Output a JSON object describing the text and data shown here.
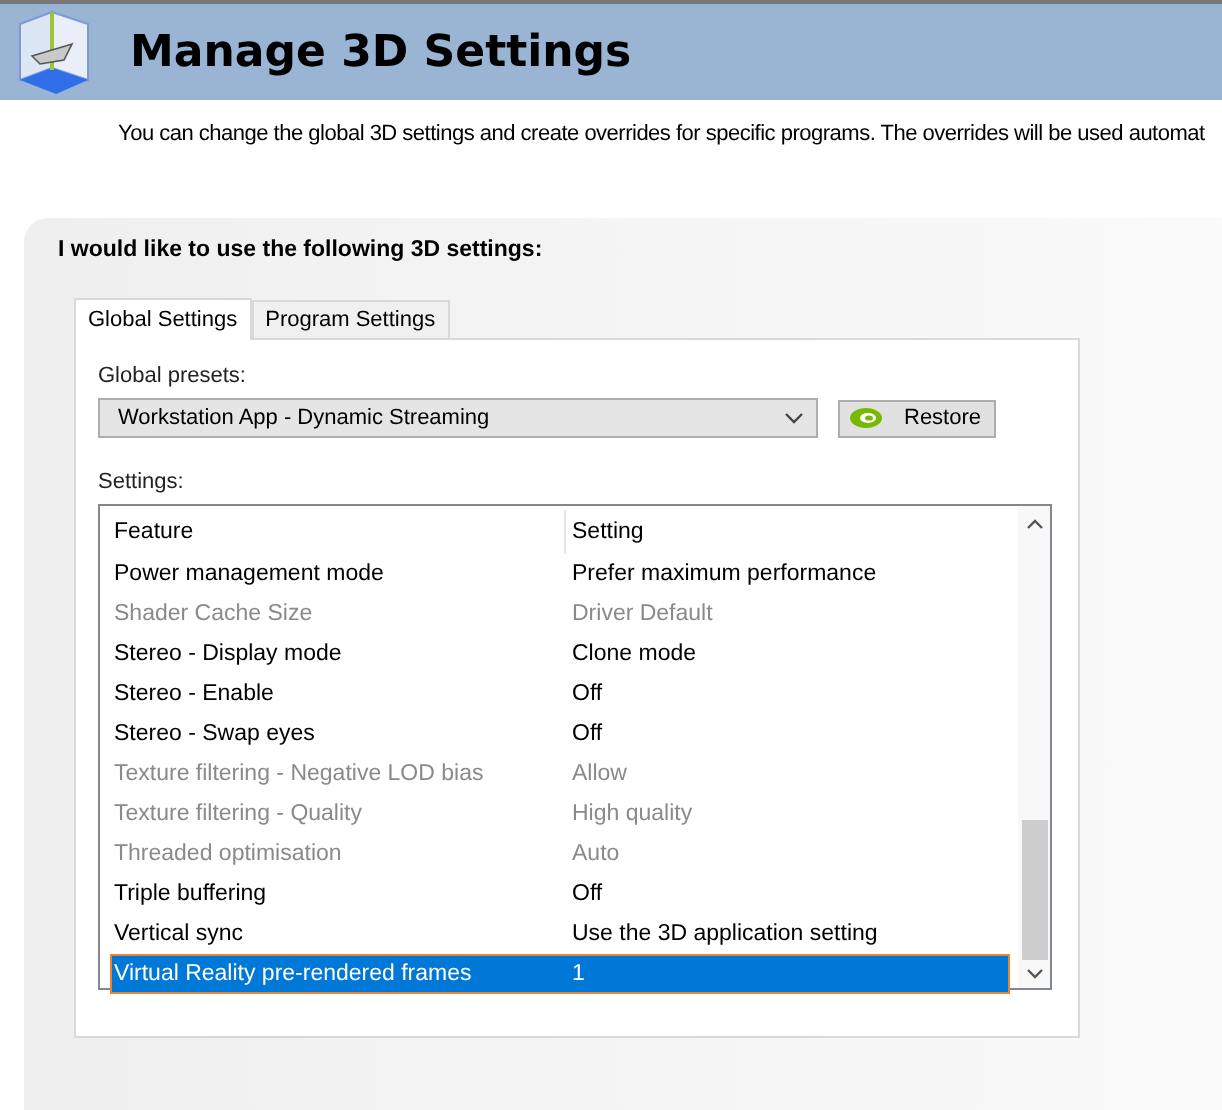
{
  "header": {
    "title": "Manage 3D Settings"
  },
  "description": "You can change the global 3D settings and create overrides for specific programs. The overrides will be used automat",
  "panel": {
    "heading": "I would like to use the following 3D settings:",
    "tabs": [
      {
        "label": "Global Settings",
        "selected": true
      },
      {
        "label": "Program Settings",
        "selected": false
      }
    ],
    "presets_label": "Global presets:",
    "preset": {
      "value": "Workstation App - Dynamic Streaming"
    },
    "restore_button": "Restore",
    "settings_label": "Settings:",
    "table": {
      "columns": [
        "Feature",
        "Setting"
      ],
      "rows": [
        {
          "feature": "Power management mode",
          "setting": "Prefer maximum performance",
          "disabled": false,
          "selected": false
        },
        {
          "feature": "Shader Cache Size",
          "setting": "Driver Default",
          "disabled": true,
          "selected": false
        },
        {
          "feature": "Stereo - Display mode",
          "setting": "Clone mode",
          "disabled": false,
          "selected": false
        },
        {
          "feature": "Stereo - Enable",
          "setting": "Off",
          "disabled": false,
          "selected": false
        },
        {
          "feature": "Stereo - Swap eyes",
          "setting": "Off",
          "disabled": false,
          "selected": false
        },
        {
          "feature": "Texture filtering - Negative LOD bias",
          "setting": "Allow",
          "disabled": true,
          "selected": false
        },
        {
          "feature": "Texture filtering - Quality",
          "setting": "High quality",
          "disabled": true,
          "selected": false
        },
        {
          "feature": "Threaded optimisation",
          "setting": "Auto",
          "disabled": true,
          "selected": false
        },
        {
          "feature": "Triple buffering",
          "setting": "Off",
          "disabled": false,
          "selected": false
        },
        {
          "feature": "Vertical sync",
          "setting": "Use the 3D application setting",
          "disabled": false,
          "selected": false
        },
        {
          "feature": "Virtual Reality pre-rendered frames",
          "setting": "1",
          "disabled": false,
          "selected": true
        }
      ]
    }
  }
}
